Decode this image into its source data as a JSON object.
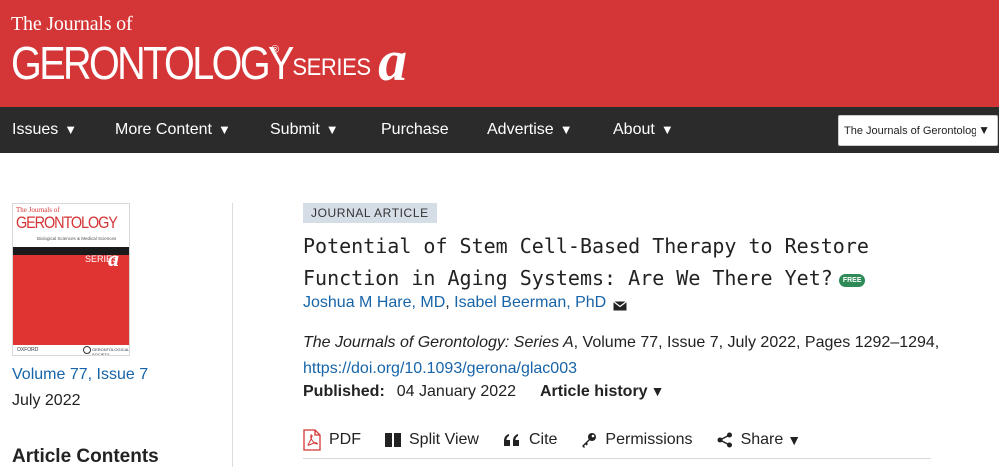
{
  "header": {
    "logo_top": "The Journals of",
    "logo_main": "GERONTOLOGY",
    "logo_reg": "®",
    "logo_series": "SERIES",
    "logo_letter": "a",
    "brand_color": "#d43536"
  },
  "nav": {
    "items": [
      {
        "label": "Issues",
        "caret": "▼"
      },
      {
        "label": "More Content",
        "caret": "▼"
      },
      {
        "label": "Submit",
        "caret": "▼"
      },
      {
        "label": "Purchase",
        "caret": ""
      },
      {
        "label": "Advertise",
        "caret": "▼"
      },
      {
        "label": "About",
        "caret": "▼"
      }
    ],
    "journal_select_value": "The Journals of Gerontology",
    "select_caret": "▼"
  },
  "sidebar": {
    "cover": {
      "journal_small": "The Journals of",
      "journal_name": "GERONTOLOGY",
      "subtitle": "Biological Sciences & Medical Sciences",
      "series": "SERIES",
      "letter": "a",
      "publisher": "OXFORD",
      "society": "GERONTOLOGICAL SOCIETY"
    },
    "volume_issue": "Volume 77, Issue 7",
    "issue_date": "July 2022",
    "contents_heading": "Article Contents"
  },
  "article": {
    "type_badge": "JOURNAL ARTICLE",
    "title": "Potential of Stem Cell-Based Therapy to Restore Function in Aging Systems: Are We There Yet?",
    "free_label": "FREE",
    "authors": [
      {
        "name": "Joshua M Hare, MD"
      },
      {
        "name": "Isabel Beerman, PhD"
      }
    ],
    "author_separator": ", ",
    "citation": {
      "journal": "The Journals of Gerontology: Series A",
      "details": ", Volume 77, Issue 7, July 2022, Pages 1292–1294,",
      "doi": "https://doi.org/10.1093/gerona/glac003"
    },
    "published_label": "Published:",
    "published_date": "04 January 2022",
    "history_label": "Article history",
    "history_caret": "▼"
  },
  "toolbar": {
    "pdf_label": "PDF",
    "split_label": "Split View",
    "cite_label": "Cite",
    "permissions_label": "Permissions",
    "share_label": "Share",
    "share_caret": "▼"
  },
  "colors": {
    "link": "#1764a8",
    "nav_bg": "#2b2b2b",
    "badge_bg": "#d5dde7",
    "free_badge": "#2e8b57"
  }
}
